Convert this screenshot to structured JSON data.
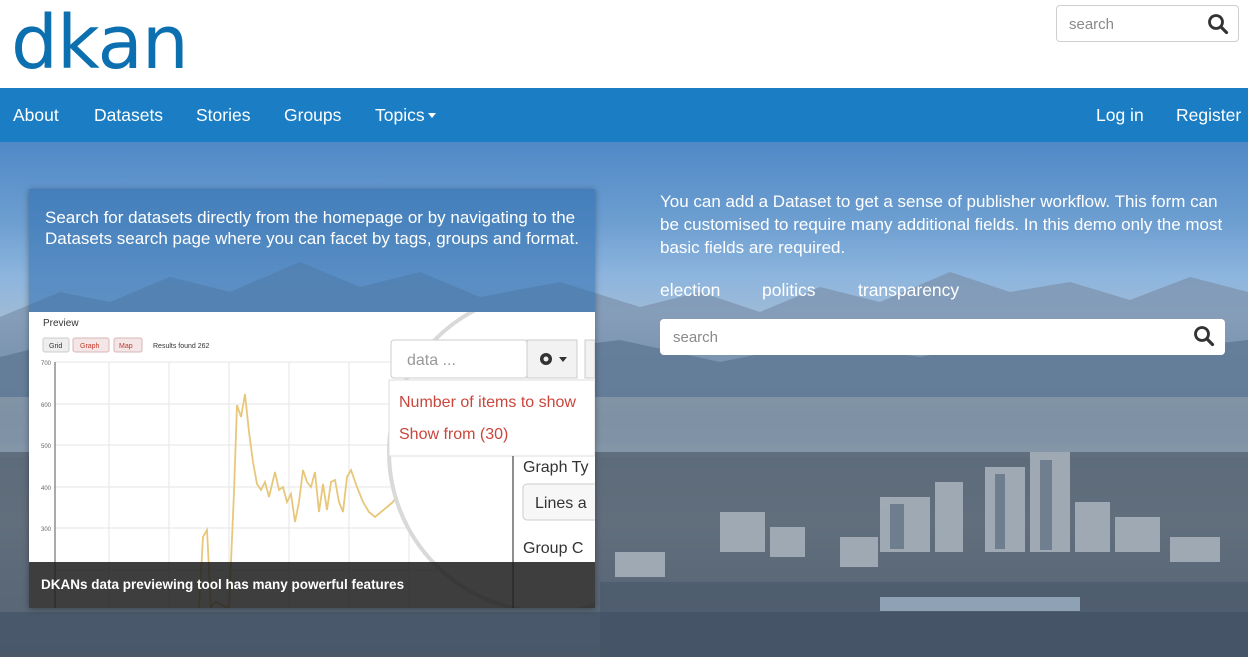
{
  "brand": {
    "logo_text": "dkan",
    "color": "#0c6fb0"
  },
  "header_search": {
    "placeholder": "search",
    "icon": "search-icon"
  },
  "nav": {
    "items": [
      "About",
      "Datasets",
      "Stories",
      "Groups",
      "Topics"
    ],
    "topics_has_dropdown": true,
    "login": "Log in",
    "register": "Register",
    "background": "#1b7dc4"
  },
  "hero": {
    "card": {
      "text": "Search for datasets directly from the homepage or by navigating to the Datasets search page where you can facet by tags, groups and format.",
      "caption": "DKANs data previewing tool has many powerful features",
      "preview": {
        "title": "Preview",
        "buttons": [
          "Grid",
          "Graph",
          "Map"
        ],
        "results": "Results found 262",
        "y_ticks": [
          "700",
          "600",
          "500",
          "400",
          "300"
        ],
        "search_placeholder": "data ...",
        "menu_items": [
          "Number of items to show",
          "Show from (30)"
        ],
        "labels": [
          "Graph Ty",
          "Lines a",
          "Group C"
        ]
      }
    },
    "description": "You can add a Dataset to get a sense of publisher workflow. This form can be customised to require many additional fields. In this demo only the most basic fields are required.",
    "tags": [
      "election",
      "politics",
      "transparency"
    ],
    "search": {
      "placeholder": "search",
      "icon": "search-icon"
    }
  }
}
